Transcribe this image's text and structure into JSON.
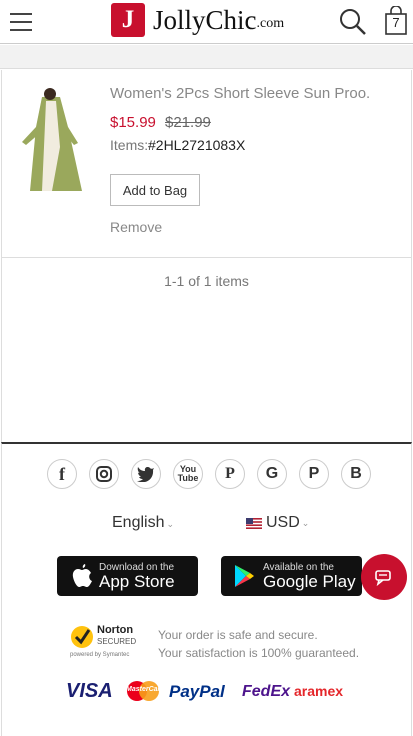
{
  "header": {
    "logo_letter": "J",
    "logo_name": "JollyChic",
    "logo_suffix": ".com",
    "cart_count": "7"
  },
  "cart": {
    "item": {
      "title": "Women's 2Pcs Short Sleeve Sun Proo...",
      "price": "$15.99",
      "original_price": "$21.99",
      "sku_label": "Items:",
      "sku": "#2HL2721083X",
      "add_to_bag_label": "Add to Bag",
      "remove_label": "Remove"
    },
    "pagination": "1-1 of 1 items"
  },
  "footer": {
    "social_icons": [
      "facebook-icon",
      "instagram-icon",
      "twitter-icon",
      "youtube-icon",
      "pinterest-icon",
      "google-icon",
      "p-icon",
      "b-icon"
    ],
    "language": "English",
    "currency": "USD",
    "app_store": {
      "small": "Download on the",
      "big": "App Store"
    },
    "google_play": {
      "small": "Available on the",
      "big": "Google Play"
    },
    "norton": {
      "line1": "Norton",
      "line2": "SECURED",
      "line3": "powered by Symantec"
    },
    "secure_line1": "Your order is safe and secure.",
    "secure_line2": "Your satisfaction is 100% guaranteed.",
    "payments": {
      "visa": "VISA",
      "mastercard": "MasterCard",
      "paypal": "PayPal",
      "fedex": "FedEx",
      "aramex": "aramex"
    }
  },
  "colors": {
    "brand": "#c8102e",
    "price": "#c8102e",
    "divider": "#333333"
  }
}
